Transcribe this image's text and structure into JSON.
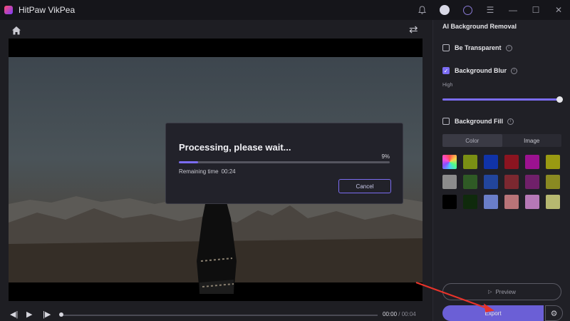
{
  "app": {
    "title": "HitPaw VikPea"
  },
  "titlebar": {
    "icons": [
      "bell-icon",
      "avatar-icon",
      "user-icon",
      "menu-icon",
      "minimize-icon",
      "maximize-icon",
      "close-icon"
    ]
  },
  "player": {
    "current_time": "00:00",
    "separator": " / ",
    "total_time": "00:04",
    "playhead_fraction": 0.0
  },
  "dialog": {
    "title": "Processing, please wait...",
    "percent": "9%",
    "progress": 0.09,
    "remaining_label": "Remaining time",
    "remaining_value": "00:24",
    "cancel_label": "Cancel"
  },
  "panel": {
    "title": "AI Background Removal",
    "options": {
      "transparent": {
        "label": "Be Transparent",
        "checked": false
      },
      "blur": {
        "label": "Background Blur",
        "checked": true,
        "level_label": "High",
        "level": 1.0
      },
      "fill": {
        "label": "Background Fill",
        "checked": false
      }
    },
    "fill_tabs": [
      {
        "label": "Color",
        "active": true
      },
      {
        "label": "Image",
        "active": false
      }
    ],
    "swatches": [
      [
        "gradient",
        "#7a8f14",
        "#1033a8",
        "#8b1420",
        "#9c1290",
        "#999a12"
      ],
      [
        "#8c8c8c",
        "#2f5a25",
        "#22459c",
        "#7b2830",
        "#70206a",
        "#8a8a22"
      ],
      [
        "#000000",
        "#0f2a0c",
        "#6a7ec8",
        "#b87478",
        "#b678b6",
        "#b6b870"
      ]
    ],
    "preview_label": "Preview",
    "export_label": "Export"
  },
  "colors": {
    "accent": "#7b6cf2",
    "annotation_arrow": "#e8332a"
  }
}
